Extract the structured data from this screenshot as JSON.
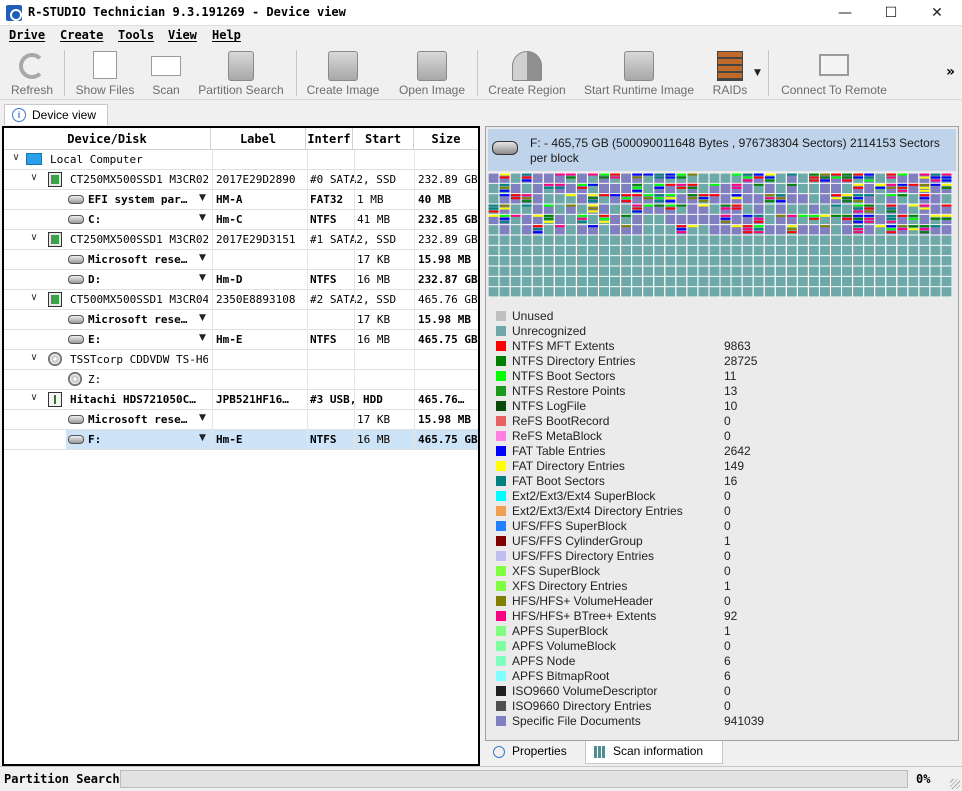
{
  "window": {
    "title": "R-STUDIO Technician 9.3.191269 - Device view",
    "minimize": "—",
    "maximize": "☐",
    "close": "✕"
  },
  "menu": [
    "Drive",
    "Create",
    "Tools",
    "View",
    "Help"
  ],
  "toolbar": {
    "refresh": "Refresh",
    "show_files": "Show Files",
    "scan": "Scan",
    "partition_search": "Partition Search",
    "create_image": "Create Image",
    "open_image": "Open Image",
    "create_region": "Create Region",
    "start_runtime_image": "Start Runtime Image",
    "raids": "RAIDs",
    "connect_to_remote": "Connect To Remote",
    "overflow": "»"
  },
  "tab": {
    "device_view": "Device view",
    "icon": "i"
  },
  "table": {
    "headers": [
      "Device/Disk",
      "Label",
      "Interf",
      "Start",
      "Size"
    ],
    "rows": [
      {
        "name": "Local Computer",
        "label": "",
        "interf": "",
        "start": "",
        "size": "",
        "icon": "computer-icon",
        "indent": 0,
        "expand": "∨",
        "bold": false
      },
      {
        "name": "CT250MX500SSD1 M3CR023",
        "label": "2017E29D2890",
        "interf": "#0 SATA2, SSD",
        "start": "",
        "size": "232.89 GB",
        "icon": "ssd-icon",
        "indent": 1,
        "expand": "∨",
        "bold": false
      },
      {
        "name": "EFI system par…",
        "label": "HM-A",
        "interf": "FAT32",
        "start": "1 MB",
        "size": "40 MB",
        "icon": "partition-icon",
        "indent": 2,
        "dropdown": true,
        "bold": true
      },
      {
        "name": "C:",
        "label": "Hm-C",
        "interf": "NTFS",
        "start": "41 MB",
        "size": "232.85 GB",
        "icon": "partition-icon",
        "indent": 2,
        "dropdown": true,
        "bold": true
      },
      {
        "name": "CT250MX500SSD1 M3CR023",
        "label": "2017E29D3151",
        "interf": "#1 SATA2, SSD",
        "start": "",
        "size": "232.89 GB",
        "icon": "ssd-icon",
        "indent": 1,
        "expand": "∨",
        "bold": false
      },
      {
        "name": "Microsoft rese…",
        "label": "",
        "interf": "",
        "start": "17 KB",
        "size": "15.98 MB",
        "icon": "partition-icon",
        "indent": 2,
        "dropdown": true,
        "bold": true
      },
      {
        "name": "D:",
        "label": "Hm-D",
        "interf": "NTFS",
        "start": "16 MB",
        "size": "232.87 GB",
        "icon": "partition-icon",
        "indent": 2,
        "dropdown": true,
        "bold": true
      },
      {
        "name": "CT500MX500SSD1 M3CR046",
        "label": "2350E8893108",
        "interf": "#2 SATA2, SSD",
        "start": "",
        "size": "465.76 GB",
        "icon": "ssd-icon",
        "indent": 1,
        "expand": "∨",
        "bold": false
      },
      {
        "name": "Microsoft rese…",
        "label": "",
        "interf": "",
        "start": "17 KB",
        "size": "15.98 MB",
        "icon": "partition-icon",
        "indent": 2,
        "dropdown": true,
        "bold": true
      },
      {
        "name": "E:",
        "label": "Hm-E",
        "interf": "NTFS",
        "start": "16 MB",
        "size": "465.75 GB",
        "icon": "partition-icon",
        "indent": 2,
        "dropdown": true,
        "bold": true
      },
      {
        "name": "TSSTcorp CDDVDW TS-H6…",
        "label": "",
        "interf": "",
        "start": "",
        "size": "",
        "icon": "cdrom-icon",
        "indent": 1,
        "expand": "∨",
        "bold": false
      },
      {
        "name": "Z:",
        "label": "",
        "interf": "",
        "start": "",
        "size": "",
        "icon": "cdrom-icon",
        "indent": 2,
        "bold": false
      },
      {
        "name": "Hitachi HDS721050C…",
        "label": "JPB521HF16…",
        "interf": "#3 USB, HDD",
        "start": "",
        "size": "465.76…",
        "icon": "usb-disk-icon",
        "indent": 1,
        "expand": "∨",
        "bold": true
      },
      {
        "name": "Microsoft rese…",
        "label": "",
        "interf": "",
        "start": "17 KB",
        "size": "15.98 MB",
        "icon": "partition-icon",
        "indent": 2,
        "dropdown": true,
        "bold": true
      },
      {
        "name": "F:",
        "label": "Hm-E",
        "interf": "NTFS",
        "start": "16 MB",
        "size": "465.75 GB",
        "icon": "partition-icon",
        "indent": 2,
        "dropdown": true,
        "bold": true,
        "selected": true
      }
    ]
  },
  "scan_info": {
    "header": "F: - 465,75 GB (500090011648 Bytes , 976738304 Sectors) 2114153 Sectors per block",
    "legend": [
      {
        "name": "Unused",
        "count": "",
        "color": "#c0c0c0"
      },
      {
        "name": "Unrecognized",
        "count": "",
        "color": "#6fa8a8"
      },
      {
        "name": "NTFS MFT Extents",
        "count": "9863",
        "color": "#ff0000"
      },
      {
        "name": "NTFS Directory Entries",
        "count": "28725",
        "color": "#008000"
      },
      {
        "name": "NTFS Boot Sectors",
        "count": "11",
        "color": "#00ff00"
      },
      {
        "name": "NTFS Restore Points",
        "count": "13",
        "color": "#1a9a1a"
      },
      {
        "name": "NTFS LogFile",
        "count": "10",
        "color": "#0a4a0a"
      },
      {
        "name": "ReFS BootRecord",
        "count": "0",
        "color": "#e86060"
      },
      {
        "name": "ReFS MetaBlock",
        "count": "0",
        "color": "#ff80e0"
      },
      {
        "name": "FAT Table Entries",
        "count": "2642",
        "color": "#0000ff"
      },
      {
        "name": "FAT Directory Entries",
        "count": "149",
        "color": "#ffff00"
      },
      {
        "name": "FAT Boot Sectors",
        "count": "16",
        "color": "#008080"
      },
      {
        "name": "Ext2/Ext3/Ext4 SuperBlock",
        "count": "0",
        "color": "#00ffff"
      },
      {
        "name": "Ext2/Ext3/Ext4 Directory Entries",
        "count": "0",
        "color": "#f0a050"
      },
      {
        "name": "UFS/FFS SuperBlock",
        "count": "0",
        "color": "#2080ff"
      },
      {
        "name": "UFS/FFS CylinderGroup",
        "count": "1",
        "color": "#800000"
      },
      {
        "name": "UFS/FFS Directory Entries",
        "count": "0",
        "color": "#c0c0f0"
      },
      {
        "name": "XFS SuperBlock",
        "count": "0",
        "color": "#80ff40"
      },
      {
        "name": "XFS Directory Entries",
        "count": "1",
        "color": "#80ff40"
      },
      {
        "name": "HFS/HFS+ VolumeHeader",
        "count": "0",
        "color": "#808000"
      },
      {
        "name": "HFS/HFS+ BTree+ Extents",
        "count": "92",
        "color": "#ff0080"
      },
      {
        "name": "APFS SuperBlock",
        "count": "1",
        "color": "#80ff80"
      },
      {
        "name": "APFS VolumeBlock",
        "count": "0",
        "color": "#80ffa0"
      },
      {
        "name": "APFS Node",
        "count": "6",
        "color": "#80ffc0"
      },
      {
        "name": "APFS BitmapRoot",
        "count": "6",
        "color": "#80ffff"
      },
      {
        "name": "ISO9660 VolumeDescriptor",
        "count": "0",
        "color": "#202020"
      },
      {
        "name": "ISO9660 Directory Entries",
        "count": "0",
        "color": "#505050"
      },
      {
        "name": "Specific File Documents",
        "count": "941039",
        "color": "#8080c0"
      }
    ]
  },
  "bottom_tabs": {
    "properties": "Properties",
    "scan_information": "Scan information"
  },
  "status": {
    "label": "Partition Search",
    "percent": "0%",
    "progress": 0
  }
}
